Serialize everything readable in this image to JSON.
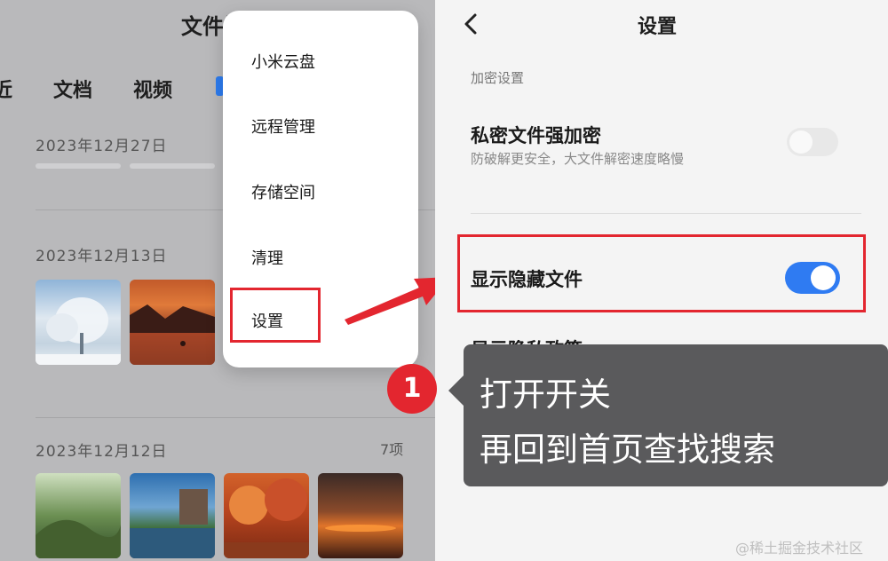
{
  "file_app": {
    "title": "文件管",
    "tabs": [
      "近",
      "文档",
      "视频"
    ],
    "groups": [
      {
        "date": "2023年12月27日"
      },
      {
        "date": "2023年12月13日"
      },
      {
        "date": "2023年12月12日",
        "count": "7项"
      }
    ]
  },
  "menu": {
    "items": [
      "小米云盘",
      "远程管理",
      "存储空间",
      "清理",
      "设置"
    ]
  },
  "settings": {
    "title": "设置",
    "section_label": "加密设置",
    "rows": [
      {
        "title": "私密文件强加密",
        "subtitle": "防破解更安全，大文件解密速度略慢",
        "toggle": "off"
      },
      {
        "title": "显示隐藏文件",
        "toggle": "on"
      },
      {
        "title": "显示隐私政策"
      }
    ]
  },
  "annotation": {
    "step": "1",
    "line1": "打开开关",
    "line2": "再回到首页查找搜索"
  },
  "watermark": "@稀土掘金技术社区",
  "colors": {
    "accent": "#2f7bf2",
    "highlight": "#e3262f",
    "callout": "#5a5a5c"
  }
}
